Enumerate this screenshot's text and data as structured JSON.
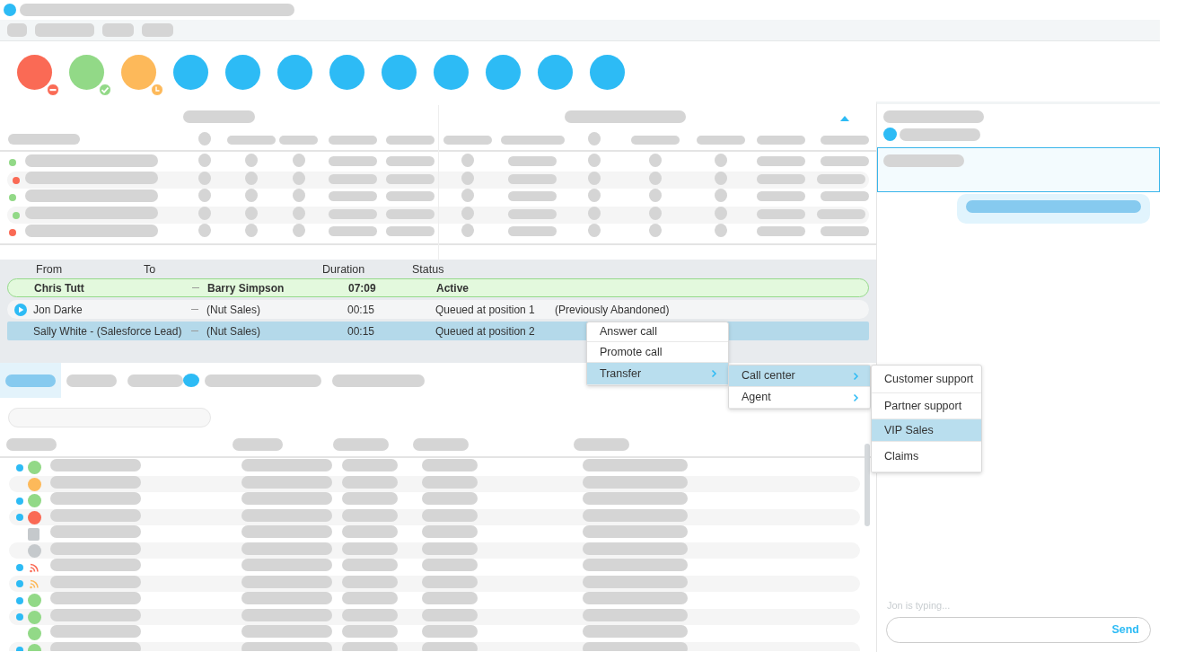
{
  "status_buttons": [
    {
      "color": "#fa6a55",
      "kind": "busy"
    },
    {
      "color": "#92d987",
      "kind": "available"
    },
    {
      "color": "#fdb95a",
      "kind": "away"
    },
    {
      "color": "#2dbbf5",
      "kind": "plain"
    },
    {
      "color": "#2dbbf5",
      "kind": "plain"
    },
    {
      "color": "#2dbbf5",
      "kind": "plain"
    },
    {
      "color": "#2dbbf5",
      "kind": "plain"
    },
    {
      "color": "#2dbbf5",
      "kind": "plain"
    },
    {
      "color": "#2dbbf5",
      "kind": "plain"
    },
    {
      "color": "#2dbbf5",
      "kind": "plain"
    },
    {
      "color": "#2dbbf5",
      "kind": "plain"
    },
    {
      "color": "#2dbbf5",
      "kind": "plain"
    }
  ],
  "stats": {
    "rows": [
      {
        "color": "#92d987"
      },
      {
        "color": "#fa6a55"
      },
      {
        "color": "#92d987"
      },
      {
        "color": "#92d987"
      },
      {
        "color": "#fa6a55"
      }
    ]
  },
  "calls": {
    "columns": [
      "From",
      "To",
      "Duration",
      "Status"
    ],
    "rows": [
      {
        "kind": "active",
        "from": "Chris Tutt",
        "to": "Barry Simpson",
        "duration": "07:09",
        "status": "Active",
        "selected": false,
        "playing": false
      },
      {
        "kind": "queued",
        "from": "Jon Darke",
        "to": "(Nut Sales)",
        "duration": "00:15",
        "status": "Queued at position 1",
        "note": "(Previously Abandoned)",
        "selected": false,
        "playing": true
      },
      {
        "kind": "queued",
        "from": "Sally White - (Salesforce Lead)",
        "to": "(Nut Sales)",
        "duration": "00:15",
        "status": "Queued at position 2",
        "selected": true,
        "playing": false
      }
    ]
  },
  "context_menu": {
    "items": [
      {
        "label": "Answer call",
        "selected": false,
        "submenu": false
      },
      {
        "label": "Promote call",
        "selected": false,
        "submenu": false
      },
      {
        "label": "Transfer",
        "selected": true,
        "submenu": true
      }
    ]
  },
  "transfer_menu": {
    "items": [
      {
        "label": "Call center",
        "selected": true,
        "submenu": true
      },
      {
        "label": "Agent",
        "selected": false,
        "submenu": true
      }
    ]
  },
  "call_center_menu": {
    "items": [
      {
        "label": "Customer support",
        "selected": false
      },
      {
        "label": "Partner support",
        "selected": false
      },
      {
        "label": "VIP Sales",
        "selected": true
      },
      {
        "label": "Claims",
        "selected": false
      }
    ]
  },
  "tabs": [
    {
      "selected": true,
      "badge": false
    },
    {
      "selected": false,
      "badge": false
    },
    {
      "selected": false,
      "badge": true
    },
    {
      "selected": false,
      "badge": false
    },
    {
      "selected": false,
      "badge": false
    }
  ],
  "contacts": [
    {
      "unread": true,
      "kind": "circle",
      "color": "#92d987"
    },
    {
      "unread": false,
      "kind": "circle",
      "color": "#fdb95a"
    },
    {
      "unread": true,
      "kind": "circle",
      "color": "#92d987"
    },
    {
      "unread": true,
      "kind": "circle",
      "color": "#fa6a55"
    },
    {
      "unread": false,
      "kind": "square",
      "color": "#c5c9cc"
    },
    {
      "unread": false,
      "kind": "circle",
      "color": "#c5c9cc"
    },
    {
      "unread": true,
      "kind": "feed",
      "color": "#fa6a55"
    },
    {
      "unread": true,
      "kind": "feed",
      "color": "#fdb95a"
    },
    {
      "unread": true,
      "kind": "circle",
      "color": "#92d987"
    },
    {
      "unread": true,
      "kind": "circle",
      "color": "#92d987"
    },
    {
      "unread": false,
      "kind": "circle",
      "color": "#92d987"
    },
    {
      "unread": true,
      "kind": "circle",
      "color": "#92d987"
    }
  ],
  "chat": {
    "typing": "Jon is typing...",
    "send": "Send"
  }
}
